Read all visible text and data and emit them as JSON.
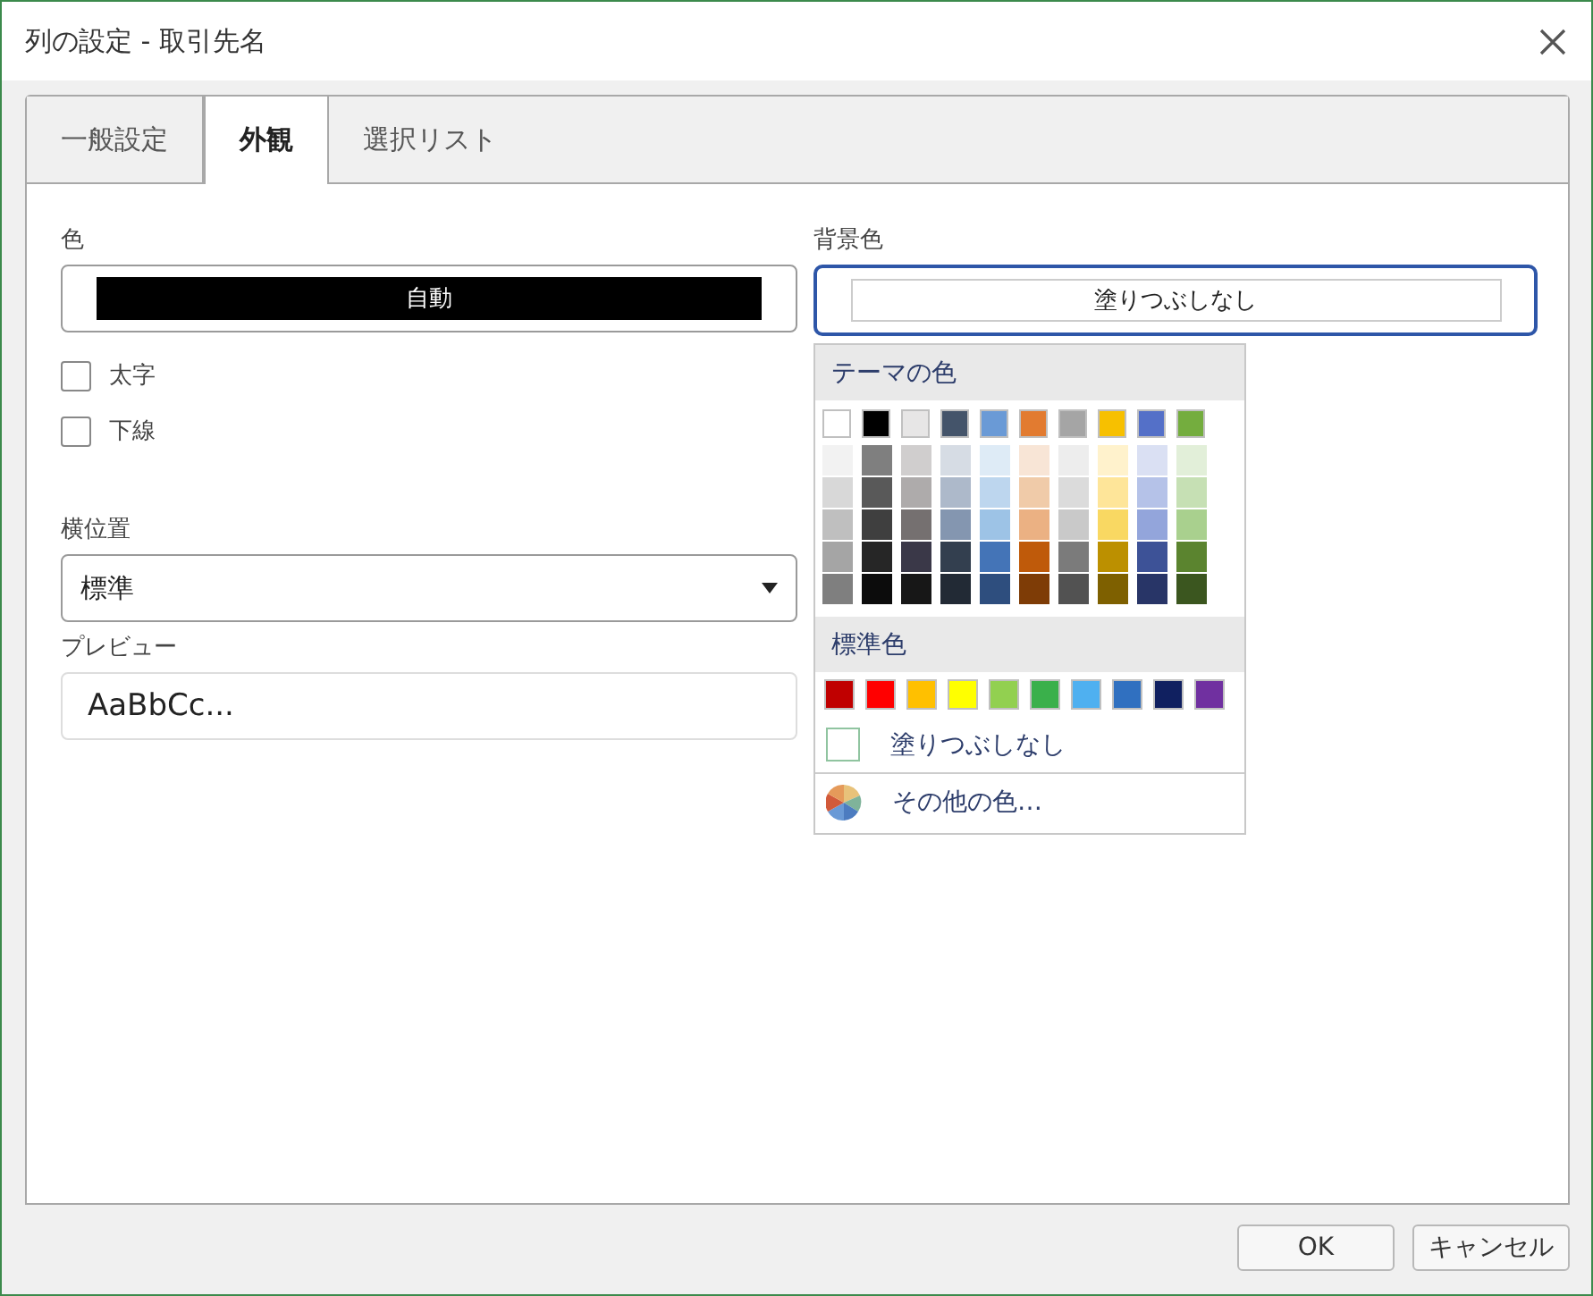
{
  "window": {
    "title": "列の設定 - 取引先名"
  },
  "tabs": [
    {
      "label": "一般設定",
      "selected": false
    },
    {
      "label": "外観",
      "selected": true
    },
    {
      "label": "選択リスト",
      "selected": false
    }
  ],
  "font_color": {
    "label": "色",
    "value": "自動"
  },
  "styles": [
    {
      "label": "太字",
      "checked": false
    },
    {
      "label": "下線",
      "checked": false
    }
  ],
  "alignment": {
    "label": "横位置",
    "value": "標準"
  },
  "preview": {
    "label": "プレビュー",
    "text": "AaBbCc..."
  },
  "background_color": {
    "label": "背景色",
    "value": "塗りつぶしなし",
    "expanded": true
  },
  "color_picker": {
    "theme_title": "テーマの色",
    "theme_colors": [
      {
        "color": "#ffffff"
      },
      {
        "color": "#000000"
      },
      {
        "color": "#e7e6e6"
      },
      {
        "color": "#44546a"
      },
      {
        "color": "#6a9ad6"
      },
      {
        "color": "#e27b30"
      },
      {
        "color": "#a5a5a5"
      },
      {
        "color": "#f7c000"
      },
      {
        "color": "#5470c8"
      },
      {
        "color": "#74ad3e"
      }
    ],
    "shades": [
      [
        {
          "color": "#f2f2f2"
        },
        {
          "color": "#7f7f7f"
        },
        {
          "color": "#d0cece"
        },
        {
          "color": "#d6dce4"
        },
        {
          "color": "#deebf6"
        },
        {
          "color": "#f8e5d6"
        },
        {
          "color": "#ededed"
        },
        {
          "color": "#fff2cc"
        },
        {
          "color": "#dae0f3"
        },
        {
          "color": "#e2efd9"
        }
      ],
      [
        {
          "color": "#d8d8d8"
        },
        {
          "color": "#595959"
        },
        {
          "color": "#aeabab"
        },
        {
          "color": "#adb9ca"
        },
        {
          "color": "#bdd6ee"
        },
        {
          "color": "#f0cba9"
        },
        {
          "color": "#dbdbdb"
        },
        {
          "color": "#fee599"
        },
        {
          "color": "#b5c2e8"
        },
        {
          "color": "#c6e0b4"
        }
      ],
      [
        {
          "color": "#bfbfbf"
        },
        {
          "color": "#3f3f3f"
        },
        {
          "color": "#757070"
        },
        {
          "color": "#8496b0"
        },
        {
          "color": "#9dc3e6"
        },
        {
          "color": "#ebb183"
        },
        {
          "color": "#c9c9c9"
        },
        {
          "color": "#f9d862"
        },
        {
          "color": "#93a5db"
        },
        {
          "color": "#a9d08e"
        }
      ],
      [
        {
          "color": "#a5a5a5"
        },
        {
          "color": "#262626"
        },
        {
          "color": "#3a3848"
        },
        {
          "color": "#333f4f"
        },
        {
          "color": "#4474b7"
        },
        {
          "color": "#bf5a0a"
        },
        {
          "color": "#7b7b7b"
        },
        {
          "color": "#bc9000"
        },
        {
          "color": "#3d5297"
        },
        {
          "color": "#5b842f"
        }
      ],
      [
        {
          "color": "#7f7f7f"
        },
        {
          "color": "#0c0c0c"
        },
        {
          "color": "#171717"
        },
        {
          "color": "#222a35"
        },
        {
          "color": "#2e4e7e"
        },
        {
          "color": "#7e3c06"
        },
        {
          "color": "#525252"
        },
        {
          "color": "#7e6000"
        },
        {
          "color": "#283567"
        },
        {
          "color": "#3b561f"
        }
      ]
    ],
    "standard_title": "標準色",
    "standard_colors": [
      {
        "color": "#c00000"
      },
      {
        "color": "#ff0000"
      },
      {
        "color": "#ffc000"
      },
      {
        "color": "#ffff00"
      },
      {
        "color": "#92d050"
      },
      {
        "color": "#3ab04b"
      },
      {
        "color": "#4fb0f0"
      },
      {
        "color": "#3070c0"
      },
      {
        "color": "#102060"
      },
      {
        "color": "#7030a0"
      }
    ],
    "no_fill": "塗りつぶしなし",
    "more_colors": "その他の色…"
  },
  "buttons": [
    "OK",
    "キャンセル"
  ]
}
